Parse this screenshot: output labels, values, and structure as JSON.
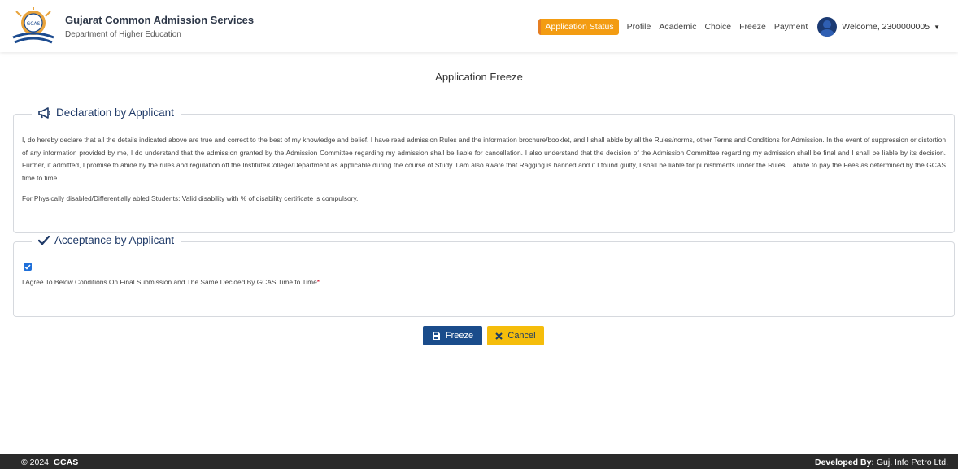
{
  "header": {
    "title": "Gujarat Common Admission Services",
    "subtitle": "Department of Higher Education",
    "logo_text": "GCAS"
  },
  "nav": {
    "items": [
      "Application Status",
      "Profile",
      "Academic",
      "Choice",
      "Freeze",
      "Payment"
    ],
    "active": "Application Status",
    "welcome": "Welcome, 2300000005"
  },
  "page": {
    "title": "Application Freeze"
  },
  "declaration": {
    "legend": "Declaration by Applicant",
    "text": "I, do hereby declare that all the details indicated above are true and correct to the best of my knowledge and belief. I have read admission Rules and the information brochure/booklet, and I shall abide by all the Rules/norms, other Terms and Conditions for Admission. In the event of suppression or distortion of any information provided by me, I do understand that the admission granted by the Admission Committee regarding my admission shall be liable for cancellation. I also understand that the decision of the Admission Committee regarding my admission shall be final and I shall be liable by its decision. Further, if admitted, I promise to abide by the rules and regulation off the Institute/College/Department as applicable during the course of Study. I am also aware that Ragging is banned and if I found guilty, I shall be liable for punishments under the Rules. I abide to pay the Fees as determined by the GCAS time to time.",
    "note": "For Physically disabled/Differentially abled Students: Valid disability with % of disability certificate is compulsory."
  },
  "acceptance": {
    "legend": "Acceptance by Applicant",
    "checked": true,
    "label": "I Agree To Below Conditions On Final Submission and The Same Decided By GCAS Time to Time",
    "required_mark": "*"
  },
  "buttons": {
    "freeze": "Freeze",
    "cancel": "Cancel"
  },
  "footer": {
    "copyright_prefix": "© 2024, ",
    "copyright_brand": "GCAS",
    "dev_label": "Developed By:",
    "dev_name": " Guj. Info Petro Ltd."
  },
  "colors": {
    "primary": "#1a4c8b",
    "accent_orange": "#f39c12",
    "cancel_yellow": "#f5bd0b",
    "legend_blue": "#1f3a68",
    "footer_bg": "#2a2a2a"
  },
  "icons": {
    "logo": "gcas-logo-icon",
    "declaration": "megaphone-icon",
    "acceptance": "check-icon",
    "freeze": "save-icon",
    "cancel": "x-icon",
    "user": "avatar-icon",
    "dropdown": "caret-down-icon"
  }
}
